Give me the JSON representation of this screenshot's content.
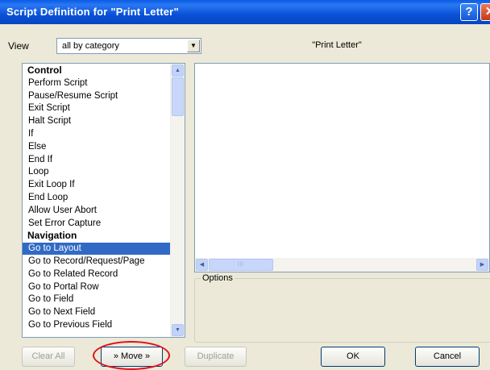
{
  "window": {
    "title": "Script Definition for \"Print Letter\"",
    "help_glyph": "?",
    "close_glyph": "✕"
  },
  "view": {
    "label": "View",
    "selected": "all by category",
    "arrow": "▼"
  },
  "script": {
    "name": "\"Print Letter\""
  },
  "steps": [
    {
      "label": "Control",
      "type": "category"
    },
    {
      "label": "Perform Script",
      "type": "item"
    },
    {
      "label": "Pause/Resume Script",
      "type": "item"
    },
    {
      "label": "Exit Script",
      "type": "item"
    },
    {
      "label": "Halt Script",
      "type": "item"
    },
    {
      "label": "If",
      "type": "item"
    },
    {
      "label": "Else",
      "type": "item"
    },
    {
      "label": "End If",
      "type": "item"
    },
    {
      "label": "Loop",
      "type": "item"
    },
    {
      "label": "Exit Loop If",
      "type": "item"
    },
    {
      "label": "End Loop",
      "type": "item"
    },
    {
      "label": "Allow User Abort",
      "type": "item"
    },
    {
      "label": "Set Error Capture",
      "type": "item"
    },
    {
      "label": "Navigation",
      "type": "category"
    },
    {
      "label": "Go to Layout",
      "type": "item",
      "selected": true
    },
    {
      "label": "Go to Record/Request/Page",
      "type": "item"
    },
    {
      "label": "Go to Related Record",
      "type": "item"
    },
    {
      "label": "Go to Portal Row",
      "type": "item"
    },
    {
      "label": "Go to Field",
      "type": "item"
    },
    {
      "label": "Go to Next Field",
      "type": "item"
    },
    {
      "label": "Go to Previous Field",
      "type": "item"
    }
  ],
  "scroll": {
    "up": "▲",
    "down": "▼",
    "left": "◀",
    "right": "▶",
    "grip": "|||"
  },
  "options": {
    "label": "Options"
  },
  "buttons": {
    "clear_all": "Clear All",
    "move": "» Move »",
    "duplicate": "Duplicate",
    "ok": "OK",
    "cancel": "Cancel"
  },
  "colors": {
    "selection": "#316ac5",
    "highlight_oval": "#e0101a",
    "titlebar": "#0a52d8"
  }
}
